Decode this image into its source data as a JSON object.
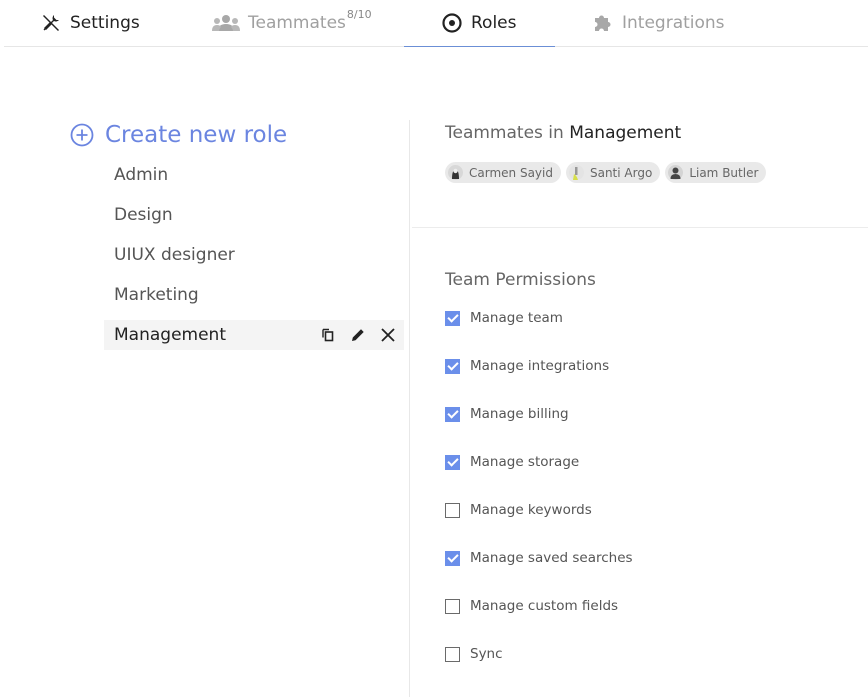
{
  "tabs": [
    {
      "id": "settings",
      "label": "Settings",
      "icon": "tools-icon",
      "state": "normal"
    },
    {
      "id": "teammates",
      "label": "Teammates",
      "badge": "8/10",
      "icon": "people-icon",
      "state": "disabled"
    },
    {
      "id": "roles",
      "label": "Roles",
      "icon": "eye-icon",
      "state": "selected"
    },
    {
      "id": "integrations",
      "label": "Integrations",
      "icon": "puzzle-icon",
      "state": "disabled"
    }
  ],
  "roles_panel": {
    "create_label": "Create new role",
    "roles": [
      {
        "name": "Admin",
        "selected": false
      },
      {
        "name": "Design",
        "selected": false
      },
      {
        "name": "UIUX designer",
        "selected": false
      },
      {
        "name": "Marketing",
        "selected": false
      },
      {
        "name": "Management",
        "selected": true
      }
    ],
    "actions": [
      "duplicate-icon",
      "edit-icon",
      "delete-icon"
    ]
  },
  "detail": {
    "teammates_prefix": "Teammates in",
    "role_name": "Management",
    "members": [
      {
        "name": "Carmen Sayid"
      },
      {
        "name": "Santi Argo"
      },
      {
        "name": "Liam Butler"
      }
    ],
    "permissions_title": "Team Permissions",
    "permissions": [
      {
        "label": "Manage team",
        "checked": true
      },
      {
        "label": "Manage integrations",
        "checked": true
      },
      {
        "label": "Manage billing",
        "checked": true
      },
      {
        "label": "Manage storage",
        "checked": true
      },
      {
        "label": "Manage keywords",
        "checked": false
      },
      {
        "label": "Manage saved searches",
        "checked": true
      },
      {
        "label": "Manage custom fields",
        "checked": false
      },
      {
        "label": "Sync",
        "checked": false
      }
    ]
  },
  "colors": {
    "accent": "#6b85e0",
    "checkbox_on": "#6b8fea",
    "tab_underline": "#6b8fd6"
  }
}
